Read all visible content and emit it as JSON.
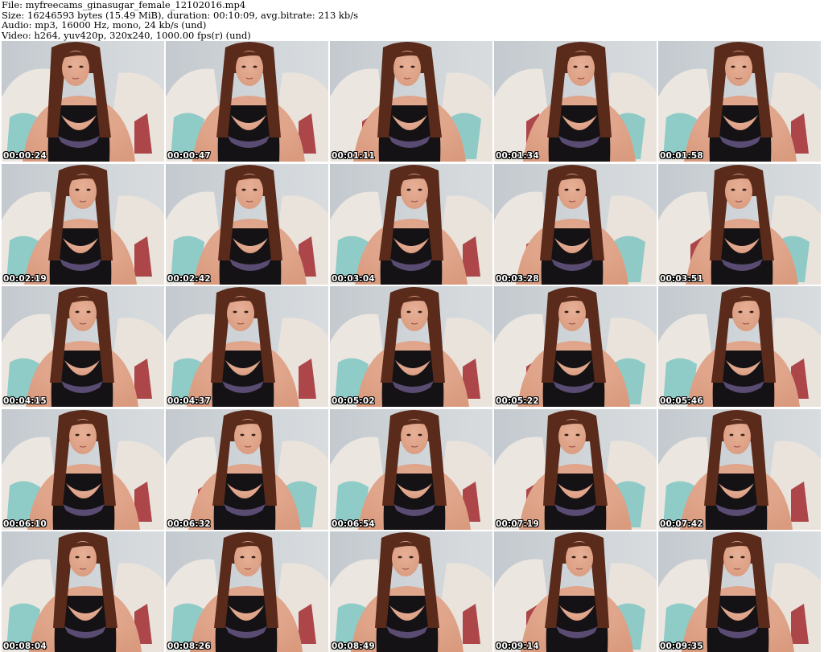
{
  "header": {
    "file": "File: myfreecams_ginasugar_female_12102016.mp4",
    "size": "Size: 16246593 bytes (15.49 MiB), duration: 00:10:09, avg.bitrate: 213 kb/s",
    "audio": "Audio: mp3, 16000 Hz, mono, 24 kb/s (und)",
    "video": "Video: h264, yuv420p, 320x240, 1000.00 fps(r) (und)"
  },
  "thumbnails": [
    {
      "timestamp": "00:00:24"
    },
    {
      "timestamp": "00:00:47"
    },
    {
      "timestamp": "00:01:11"
    },
    {
      "timestamp": "00:01:34"
    },
    {
      "timestamp": "00:01:58"
    },
    {
      "timestamp": "00:02:19"
    },
    {
      "timestamp": "00:02:42"
    },
    {
      "timestamp": "00:03:04"
    },
    {
      "timestamp": "00:03:28"
    },
    {
      "timestamp": "00:03:51"
    },
    {
      "timestamp": "00:04:15"
    },
    {
      "timestamp": "00:04:37"
    },
    {
      "timestamp": "00:05:02"
    },
    {
      "timestamp": "00:05:22"
    },
    {
      "timestamp": "00:05:46"
    },
    {
      "timestamp": "00:06:10"
    },
    {
      "timestamp": "00:06:32"
    },
    {
      "timestamp": "00:06:54"
    },
    {
      "timestamp": "00:07:19"
    },
    {
      "timestamp": "00:07:42"
    },
    {
      "timestamp": "00:08:04"
    },
    {
      "timestamp": "00:08:26"
    },
    {
      "timestamp": "00:08:49"
    },
    {
      "timestamp": "00:09:14"
    },
    {
      "timestamp": "00:09:35"
    }
  ],
  "colors": {
    "wall": "#cfd4d8",
    "chair": "#ece6e0",
    "pillow": "#7fc6c2",
    "skin": "#d99a7e",
    "hair": "#5a2a1a",
    "top": "#141214",
    "lace": "#6a5a8a",
    "red_accent": "#9e1e24"
  }
}
